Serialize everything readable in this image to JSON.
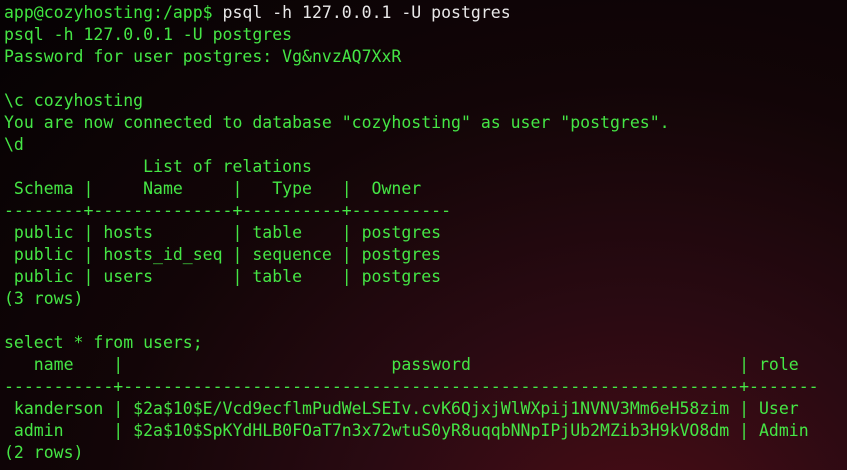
{
  "terminal": {
    "prompt": "app@cozyhosting:/app$",
    "first_command": " psql -h 127.0.0.1 -U postgres",
    "lines": [
      "psql -h 127.0.0.1 -U postgres",
      "Password for user postgres: Vg&nvzAQ7XxR",
      "",
      "\\c cozyhosting",
      "You are now connected to database \"cozyhosting\" as user \"postgres\".",
      "\\d",
      "              List of relations",
      " Schema |     Name     |   Type   |  Owner",
      "--------+--------------+----------+----------",
      " public | hosts        | table    | postgres",
      " public | hosts_id_seq | sequence | postgres",
      " public | users        | table    | postgres",
      "(3 rows)",
      "",
      "select * from users;",
      "   name    |                           password                           | role",
      "-----------+--------------------------------------------------------------+-------",
      " kanderson | $2a$10$E/Vcd9ecflmPudWeLSEIv.cvK6QjxjWlWXpij1NVNV3Mm6eH58zim | User",
      " admin     | $2a$10$SpKYdHLB0FOaT7n3x72wtuS0yR8uqqbNNpIPjUb2MZib3H9kVO8dm | Admin",
      "(2 rows)"
    ]
  }
}
